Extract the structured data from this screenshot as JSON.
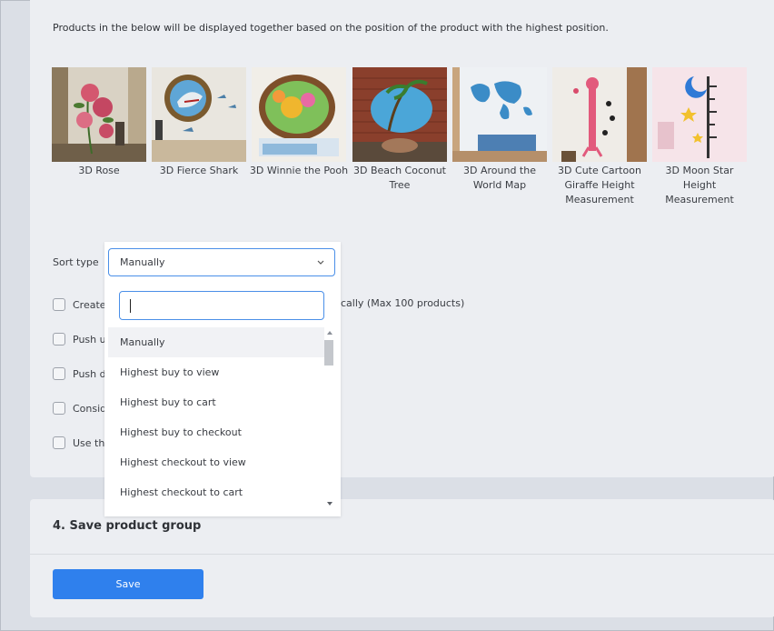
{
  "note": "Products in the below will be displayed together based on the position of the product with the highest position.",
  "products": [
    {
      "name": "3D Rose"
    },
    {
      "name": "3D Fierce Shark"
    },
    {
      "name": "3D Winnie the Pooh"
    },
    {
      "name": "3D Beach Coconut Tree"
    },
    {
      "name": "3D Around the World Map"
    },
    {
      "name": "3D Cute Cartoon Giraffe Height Measurement"
    },
    {
      "name": "3D Moon Star Height Measurement"
    }
  ],
  "sort": {
    "label": "Sort type",
    "selected": "Manually",
    "search_value": "",
    "options": [
      "Manually",
      "Highest buy to view",
      "Highest buy to cart",
      "Highest buy to checkout",
      "Highest checkout to view",
      "Highest checkout to cart"
    ]
  },
  "options_visible": [
    {
      "text": "Create"
    },
    {
      "text": "Push u"
    },
    {
      "text": "Push d"
    },
    {
      "text": "Consid"
    },
    {
      "text": "Use thi"
    }
  ],
  "option_tail": "cally (Max 100 products)",
  "save_section": {
    "title": "4. Save product group",
    "button": "Save"
  },
  "colors": {
    "accent": "#2f80ed",
    "page_bg": "#dbdfe6",
    "card_bg": "#eceef2"
  }
}
